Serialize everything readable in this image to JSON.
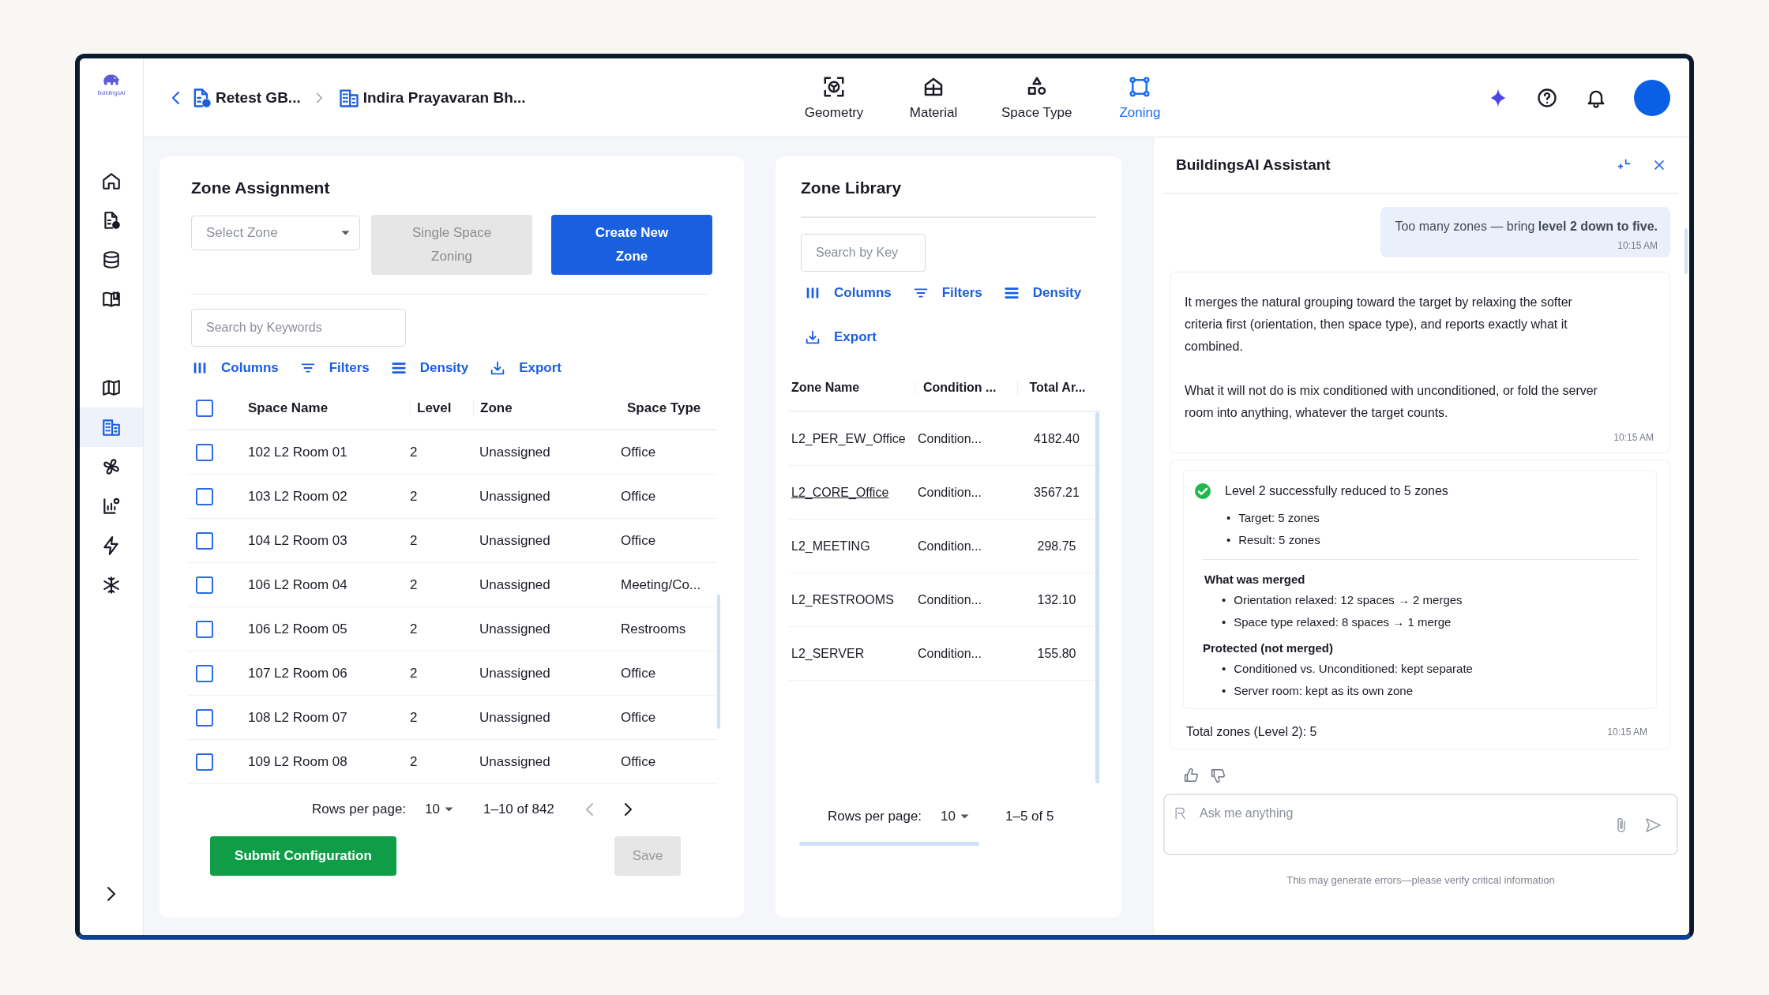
{
  "app": {
    "logo_text": "BuildingsAI"
  },
  "sidebar": {
    "nav_items": [
      {
        "kind": "home",
        "selected": false
      },
      {
        "kind": "document",
        "selected": false
      },
      {
        "kind": "database",
        "selected": false
      },
      {
        "kind": "book",
        "selected": false
      }
    ],
    "tool_items": [
      {
        "kind": "map",
        "selected": false
      },
      {
        "kind": "building",
        "selected": true
      },
      {
        "kind": "fan",
        "selected": false
      },
      {
        "kind": "chart",
        "selected": false
      },
      {
        "kind": "bolt",
        "selected": false
      },
      {
        "kind": "snowflake",
        "selected": false
      }
    ]
  },
  "breadcrumb": [
    {
      "kind": "document",
      "label": "Retest GB..."
    },
    {
      "kind": "building",
      "label": "Indira Prayavaran Bh..."
    }
  ],
  "tabs": [
    {
      "kind": "geometry",
      "label": "Geometry",
      "selected": false
    },
    {
      "kind": "material",
      "label": "Material",
      "selected": false
    },
    {
      "kind": "spacetype",
      "label": "Space Type",
      "selected": false
    },
    {
      "kind": "zoning",
      "label": "Zoning",
      "selected": true
    }
  ],
  "zone_assignment": {
    "title": "Zone Assignment",
    "zone_select": {
      "placeholder": "Select Zone"
    },
    "buttons": [
      {
        "kind": "secondary",
        "label": "Single Space Zoning",
        "disabled": true
      },
      {
        "kind": "primary",
        "label": "Create New Zone",
        "disabled": false
      }
    ],
    "search": {
      "placeholder": "Search by Keywords"
    },
    "toolbar": [
      {
        "kind": "columns",
        "label": "Columns"
      },
      {
        "kind": "filters",
        "label": "Filters"
      },
      {
        "kind": "density",
        "label": "Density"
      },
      {
        "kind": "export",
        "label": "Export"
      }
    ],
    "table": {
      "header_checked": false,
      "columns": [
        "Space Name",
        "Level",
        "Zone",
        "Space Type"
      ],
      "rows": [
        {
          "checked": false,
          "cells": [
            "102 L2 Room 01",
            "2",
            "Unassigned",
            "Office"
          ]
        },
        {
          "checked": false,
          "cells": [
            "103 L2 Room 02",
            "2",
            "Unassigned",
            "Office"
          ]
        },
        {
          "checked": false,
          "cells": [
            "104 L2 Room 03",
            "2",
            "Unassigned",
            "Office"
          ]
        },
        {
          "checked": false,
          "cells": [
            "106 L2 Room 04",
            "2",
            "Unassigned",
            "Meeting/Co..."
          ]
        },
        {
          "checked": false,
          "cells": [
            "106 L2 Room 05",
            "2",
            "Unassigned",
            "Restrooms"
          ]
        },
        {
          "checked": false,
          "cells": [
            "107 L2 Room 06",
            "2",
            "Unassigned",
            "Office"
          ]
        },
        {
          "checked": false,
          "cells": [
            "108 L2 Room 07",
            "2",
            "Unassigned",
            "Office"
          ]
        },
        {
          "checked": false,
          "cells": [
            "109 L2 Room 08",
            "2",
            "Unassigned",
            "Office"
          ]
        }
      ]
    },
    "pagination": {
      "rows_label": "Rows per page:",
      "rows_per_page": "10",
      "range": "1–10 of 842",
      "prev_disabled": true,
      "next_disabled": false
    },
    "actions": [
      {
        "kind": "submit",
        "label": "Submit Configuration",
        "disabled": false
      },
      {
        "kind": "save",
        "label": "Save",
        "disabled": true
      }
    ]
  },
  "zone_library": {
    "title": "Zone Library",
    "search": {
      "placeholder": "Search by Key"
    },
    "toolbar": [
      {
        "kind": "columns",
        "label": "Columns"
      },
      {
        "kind": "filters",
        "label": "Filters"
      },
      {
        "kind": "density",
        "label": "Density"
      },
      {
        "kind": "export",
        "label": "Export"
      }
    ],
    "table": {
      "columns": [
        "Zone Name",
        "Condition ...",
        "Total Ar..."
      ],
      "rows": [
        {
          "underlined": false,
          "cells": [
            "L2_PER_EW_Office",
            "Condition...",
            "4182.40"
          ]
        },
        {
          "underlined": true,
          "cells": [
            "L2_CORE_Office",
            "Condition...",
            "3567.21"
          ]
        },
        {
          "underlined": false,
          "cells": [
            "L2_MEETING",
            "Condition...",
            "298.75"
          ]
        },
        {
          "underlined": false,
          "cells": [
            "L2_RESTROOMS",
            "Condition...",
            "132.10"
          ]
        },
        {
          "underlined": false,
          "cells": [
            "L2_SERVER",
            "Condition...",
            "155.80"
          ]
        }
      ]
    },
    "pagination": {
      "rows_label": "Rows per page:",
      "rows_per_page": "10",
      "range": "1–5 of 5"
    }
  },
  "assistant": {
    "title": "BuildingsAI Assistant",
    "messages": [
      {
        "kind": "user",
        "text": "Too many zones — bring **level 2 down to five.**",
        "time": "10:15 AM"
      },
      {
        "kind": "assistant",
        "paragraphs": [
          "It merges the natural grouping toward the target by relaxing the softer criteria first (orientation, then space type), and reports exactly what it combined.",
          "What it will not do is mix conditioned with unconditioned, or fold the server room into anything, whatever the target counts."
        ],
        "time": "10:15 AM"
      }
    ],
    "result": {
      "success": true,
      "heading": "Level 2 successfully reduced to 5 zones",
      "bullets": [
        "•",
        "Target: 5 zones",
        "•",
        "Result: 5 zones"
      ],
      "sections": [
        {
          "title": "What was merged",
          "items": [
            "•",
            "Orientation relaxed: 12 spaces → 2 merges",
            "•",
            "Space type relaxed: 8 spaces → 1 merge"
          ]
        },
        {
          "title": "Protected (not merged)",
          "items": [
            "•",
            "Conditioned vs. Unconditioned: kept separate",
            "•",
            "Server room: kept as its own zone"
          ]
        }
      ],
      "total": "Total zones (Level 2): 5",
      "time": "10:15 AM"
    },
    "input": {
      "placeholder": "Ask me anything"
    },
    "disclaimer": "This may generate errors—please verify critical information"
  }
}
